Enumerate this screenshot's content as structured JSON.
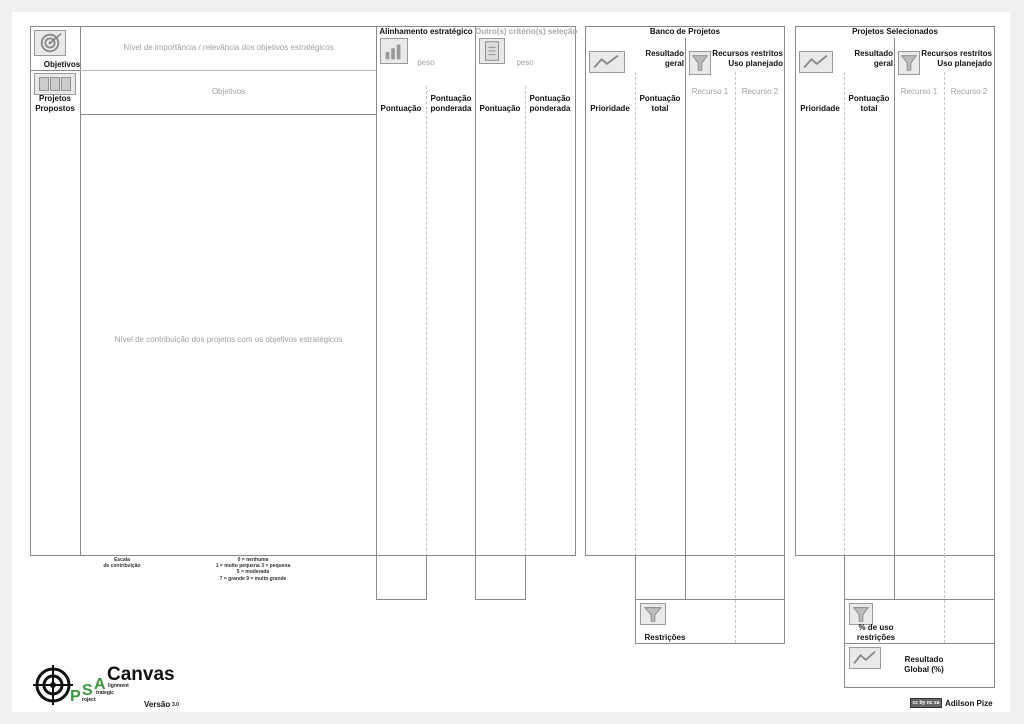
{
  "objetivos_block": {
    "importancia_hint": "Nível de importância / relevância dos objetivos estratégicos",
    "objetivos_label": "Objetivos",
    "objetivos_hint": "Objetivos",
    "projetos_label_1": "Projetos",
    "projetos_label_2": "Propostos",
    "contribuicao_hint": "Nível de contribuição dos projetos com os objetivos estratégicos"
  },
  "alinhamento": {
    "title": "Alinhamento estratégico",
    "peso": "peso",
    "pontuacao": "Pontuação",
    "ponderada_1": "Pontuação",
    "ponderada_2": "ponderada"
  },
  "outros": {
    "title": "Outro(s) critério(s) seleção",
    "peso": "peso",
    "pontuacao": "Pontuação",
    "ponderada_1": "Pontuação",
    "ponderada_2": "ponderada"
  },
  "banco": {
    "title": "Banco de Projetos",
    "resultado_1": "Resultado",
    "resultado_2": "geral",
    "recursos_1": "Recursos restritos",
    "recursos_2": "Uso planejado",
    "prioridade": "Prioridade",
    "total_1": "Pontuação",
    "total_2": "total",
    "recurso1": "Recurso 1",
    "recurso2": "Recurso 2",
    "restricoes": "Restrições"
  },
  "selecionados": {
    "title": "Projetos Selecionados",
    "resultado_1": "Resultado",
    "resultado_2": "geral",
    "recursos_1": "Recursos restritos",
    "recursos_2": "Uso planejado",
    "prioridade": "Prioridade",
    "total_1": "Pontuação",
    "total_2": "total",
    "recurso1": "Recurso 1",
    "recurso2": "Recurso 2",
    "uso_1": "% de uso",
    "uso_2": "restrições",
    "global_1": "Resultado",
    "global_2": "Global (%)"
  },
  "escala": {
    "title_1": "Escala",
    "title_2": "de contribuição",
    "line1": "0 = nenhuma",
    "line2": "1 = muito pequena      3 = pequena",
    "line3": "5 = moderada",
    "line4": "7 = grande    9 = muito grande"
  },
  "logo": {
    "canvas": "Canvas",
    "p": "P",
    "s": "S",
    "a": "A",
    "alignment": "lignment",
    "strategic": "trategic",
    "project": "roject",
    "versao": "Versão",
    "versao_num": "3.0"
  },
  "footer": {
    "license": "cc by nc sa",
    "author": "Adilson Pize"
  },
  "colors": {
    "brand_green": "#3a9a3a",
    "border": "#8a8a8a",
    "hint_grey": "#a9a9a9"
  }
}
